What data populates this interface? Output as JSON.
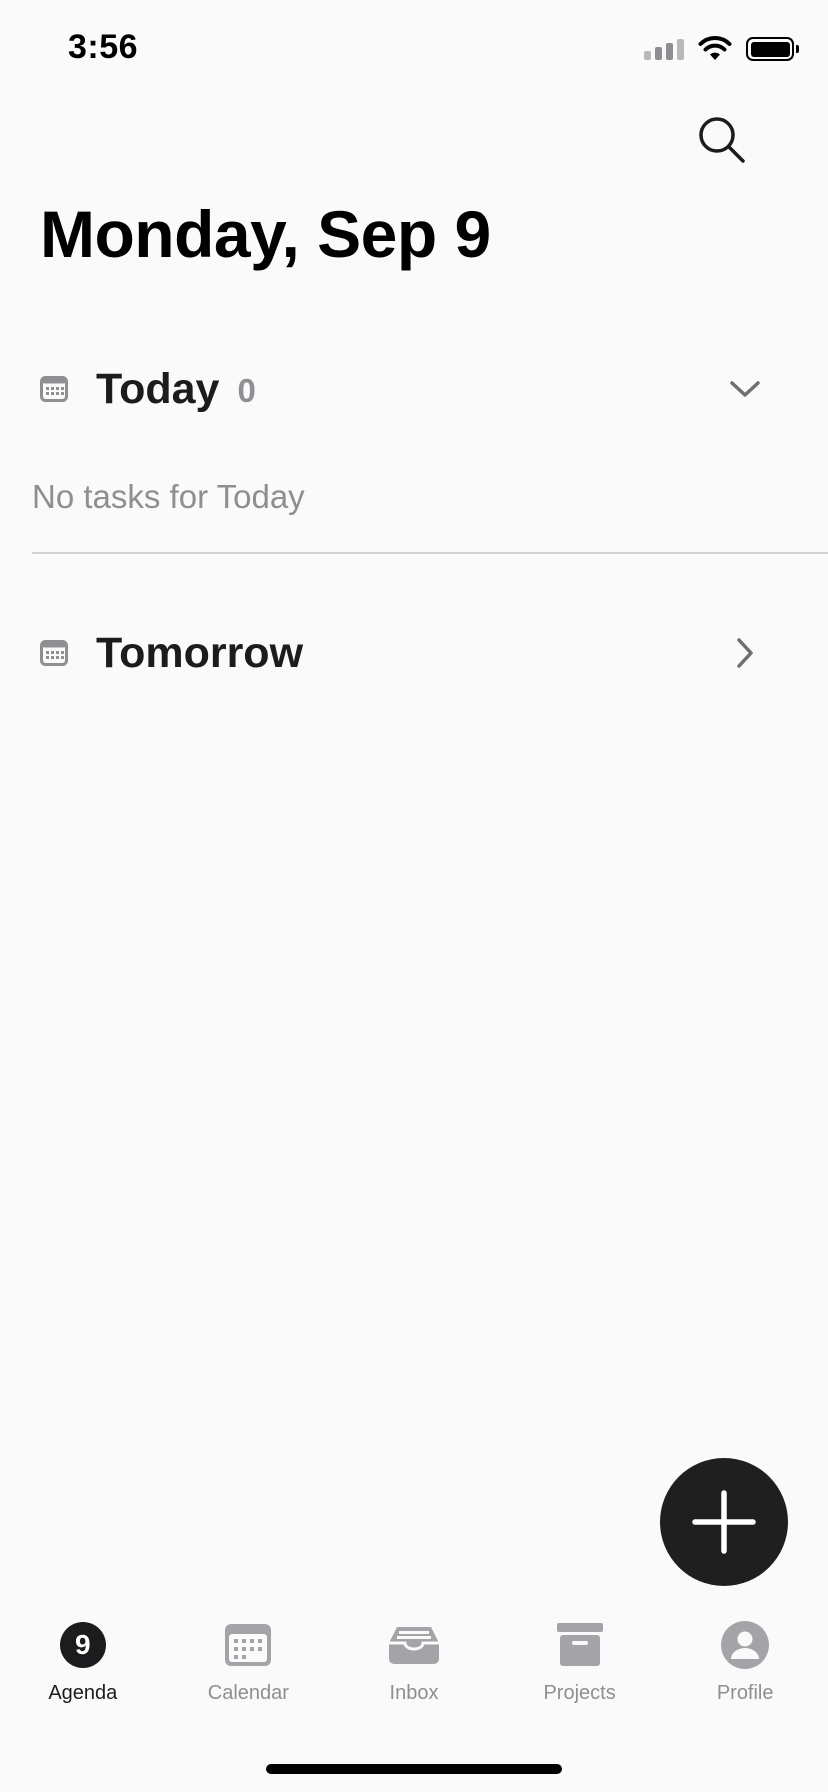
{
  "status_bar": {
    "time": "3:56"
  },
  "header": {
    "title": "Monday, Sep 9"
  },
  "sections": {
    "today": {
      "label": "Today",
      "count": "0",
      "empty_message": "No tasks for Today"
    },
    "tomorrow": {
      "label": "Tomorrow"
    }
  },
  "tabs": {
    "agenda": {
      "label": "Agenda",
      "badge": "9"
    },
    "calendar": {
      "label": "Calendar"
    },
    "inbox": {
      "label": "Inbox"
    },
    "projects": {
      "label": "Projects"
    },
    "profile": {
      "label": "Profile"
    }
  },
  "colors": {
    "background": "#fafafa",
    "primary": "#1c1c1e",
    "secondary": "#8e8e93",
    "fab": "#1f1f1f"
  },
  "icons": {
    "search": "search-icon",
    "calendar_small": "calendar-icon",
    "chevron_down": "chevron-down-icon",
    "chevron_right": "chevron-right-icon",
    "add": "plus-icon",
    "inbox": "inbox-tray-icon",
    "projects": "archive-box-icon",
    "profile": "person-circle-icon"
  }
}
